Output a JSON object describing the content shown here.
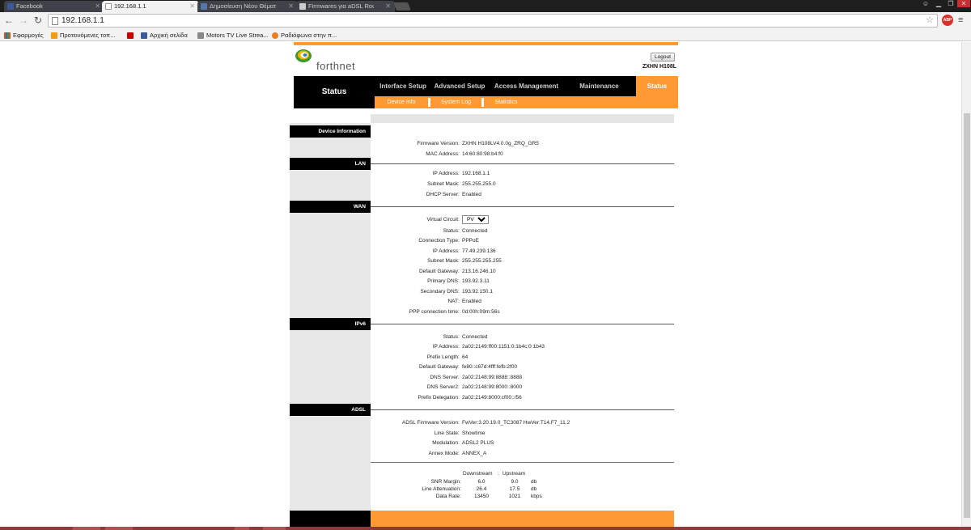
{
  "browser": {
    "tabs": [
      {
        "title": "Facebook",
        "favicon_color": "#3b5998",
        "active": false
      },
      {
        "title": "192.168.1.1",
        "favicon_color": "#dddddd",
        "active": true
      },
      {
        "title": "Δημοσίευση Νέου Θέματ",
        "favicon_color": "#5577aa",
        "active": false
      },
      {
        "title": "Firmwares για aDSL Route",
        "favicon_color": "#cccccc",
        "active": false
      }
    ],
    "url": "192.168.1.1",
    "adblock_label": "ABP",
    "bookmarks": [
      {
        "label": "Εφαρμογές",
        "icon_color": "#e34c26"
      },
      {
        "label": "Προτεινόμενες τοπ...",
        "icon_color": "#f39c12"
      },
      {
        "label": "",
        "icon_color": "#cc0000"
      },
      {
        "label": "Αρχική σελίδα",
        "icon_color": "#3b5998"
      },
      {
        "label": "Motors TV Live Strea...",
        "icon_color": "#888888"
      },
      {
        "label": "Ραδιόφωνα στην π...",
        "icon_color": "#e67e22"
      }
    ]
  },
  "router": {
    "brand": "forthnet",
    "logout_label": "Logout",
    "model": "ZXHN H108L",
    "left_title": "Status",
    "menu": [
      {
        "label": "Interface Setup",
        "active": false
      },
      {
        "label": "Advanced Setup",
        "active": false
      },
      {
        "label": "Access Management",
        "active": false
      },
      {
        "label": "Maintenance",
        "active": false
      },
      {
        "label": "Status",
        "active": true
      }
    ],
    "submenu": [
      "Device Info",
      "System Log",
      "Statistics"
    ],
    "sections": {
      "device": {
        "title": "Device Information",
        "rows": [
          {
            "label": "Firmware Version",
            "value": "ZXHN H108LV4.0.0g_ZRQ_GR5"
          },
          {
            "label": "MAC Address",
            "value": "14:60:80:98:b4:f0"
          }
        ]
      },
      "lan": {
        "title": "LAN",
        "rows": [
          {
            "label": "IP Address",
            "value": "192.168.1.1"
          },
          {
            "label": "Subnet Mask",
            "value": "255.255.255.0"
          },
          {
            "label": "DHCP Server",
            "value": "Enabled"
          }
        ]
      },
      "wan": {
        "title": "WAN",
        "virtual_circuit_label": "Virtual Circuit",
        "virtual_circuit_value": "PVC0",
        "rows": [
          {
            "label": "Status",
            "value": "Connected"
          },
          {
            "label": "Connection Type",
            "value": "PPPoE"
          },
          {
            "label": "IP Address",
            "value": "77.49.239.136"
          },
          {
            "label": "Subnet Mask",
            "value": "255.255.255.255"
          },
          {
            "label": "Default Gateway",
            "value": "213.16.246.10"
          },
          {
            "label": "Primary DNS",
            "value": "193.92.3.11"
          },
          {
            "label": "Secondary DNS",
            "value": "193.92.150.1"
          },
          {
            "label": "NAT",
            "value": "Enabled"
          },
          {
            "label": "PPP connection time",
            "value": "0d:00h:09m:56s"
          }
        ]
      },
      "ipv6": {
        "title": "IPv6",
        "rows": [
          {
            "label": "Status",
            "value": "Connected"
          },
          {
            "label": "IP Address",
            "value": "2a02:2149:ff00:1151:0:1b4c:0:1b43"
          },
          {
            "label": "Prefix Length",
            "value": "64"
          },
          {
            "label": "Default Gateway",
            "value": "fe80::c67d:4fff:fefb:2f00"
          },
          {
            "label": "DNS Server",
            "value": "2a02:2148:99:8888::8888"
          },
          {
            "label": "DNS Server2",
            "value": "2a02:2148:99:8000::8000"
          },
          {
            "label": "Prefix Delegation",
            "value": "2a02:2149:8000:cf00::/56"
          }
        ]
      },
      "adsl": {
        "title": "ADSL",
        "rows": [
          {
            "label": "ADSL Firmware Version",
            "value": "FwVer:3.20.19.0_TC3087 HwVer:T14.F7_11.2"
          },
          {
            "label": "Line State",
            "value": "Showtime"
          },
          {
            "label": "Modulation",
            "value": "ADSL2 PLUS"
          },
          {
            "label": "Annex Mode",
            "value": "ANNEX_A"
          }
        ],
        "stats_header": {
          "downstream": "Downstream",
          "upstream": "Upstream"
        },
        "stats": [
          {
            "label": "SNR Margin",
            "down": "6.0",
            "up": "9.0",
            "unit": "db"
          },
          {
            "label": "Line Attenuation",
            "down": "26.4",
            "up": "17.5",
            "unit": "db"
          },
          {
            "label": "Data Rate",
            "down": "13450",
            "up": "1021",
            "unit": "kbps"
          }
        ]
      }
    }
  }
}
